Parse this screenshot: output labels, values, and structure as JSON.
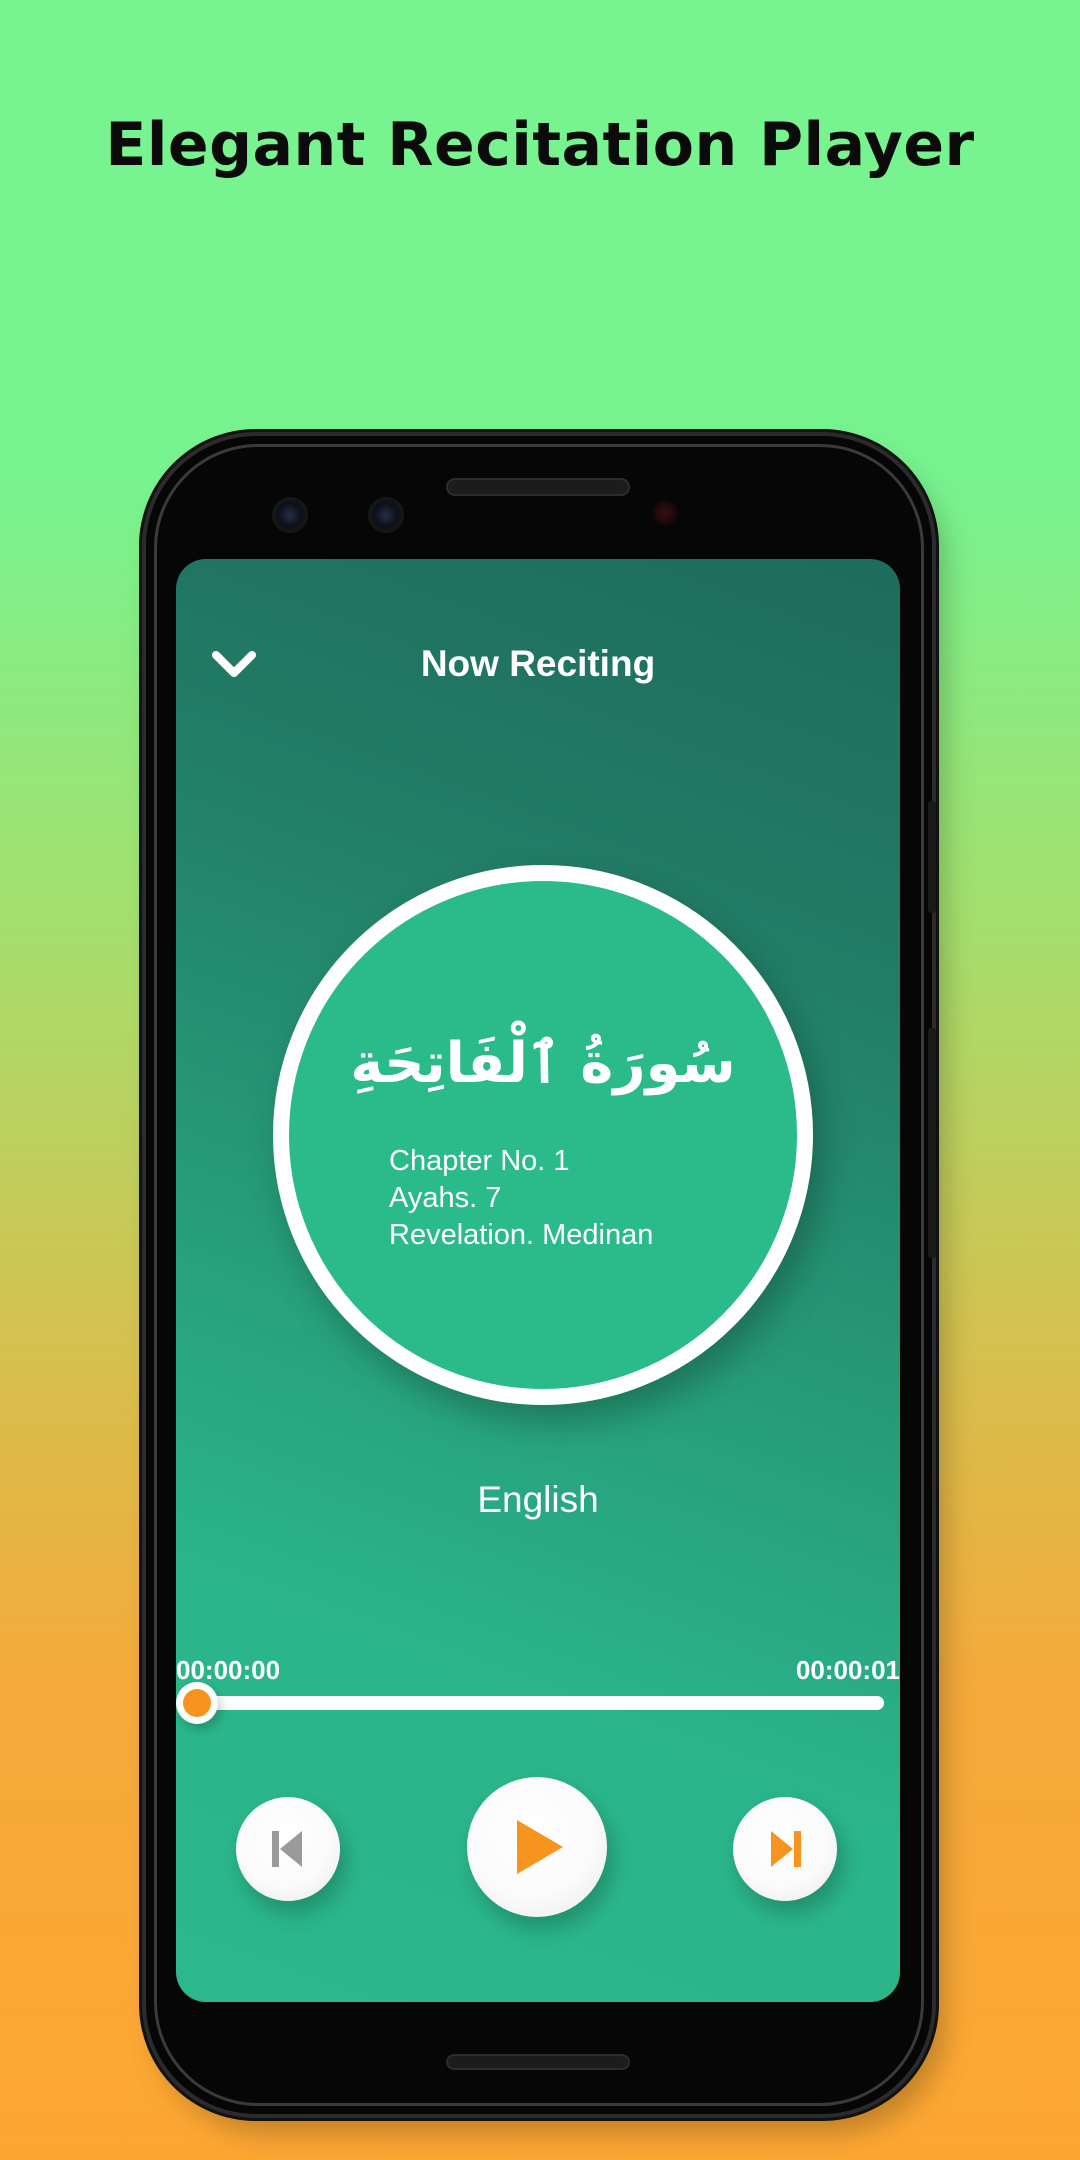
{
  "headline": "Elegant Recitation Player",
  "player": {
    "title": "Now Reciting",
    "collapse_icon": "chevron-down-icon",
    "surah": {
      "arabic_name": "سُورَةُ ٱلْفَاتِحَةِ",
      "chapter": "Chapter No. 1",
      "ayahs": "Ayahs. 7",
      "revelation": "Revelation. Medinan"
    },
    "language": "English",
    "progress": {
      "elapsed": "00:00:00",
      "total": "00:00:01",
      "fraction": 0.0
    },
    "controls": {
      "previous_icon": "skip-previous-icon",
      "play_icon": "play-icon",
      "next_icon": "skip-next-icon"
    }
  },
  "colors": {
    "screen_accent": "#2bb88b",
    "screen_dark": "#1d6b5c",
    "control_accent": "#f7941d",
    "control_muted": "#9a9a9a",
    "bg_top": "#77f38f",
    "bg_bottom": "#fda733"
  }
}
